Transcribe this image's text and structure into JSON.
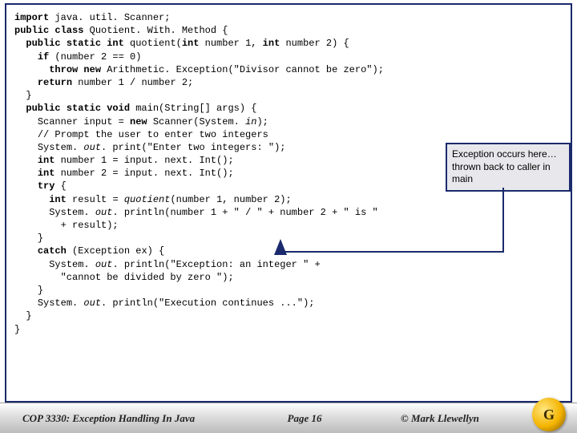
{
  "code": {
    "lines": [
      {
        "indent": 0,
        "segs": [
          {
            "t": "import ",
            "c": "kw"
          },
          {
            "t": "java. util. Scanner;"
          }
        ]
      },
      {
        "indent": 0,
        "segs": [
          {
            "t": ""
          }
        ]
      },
      {
        "indent": 0,
        "segs": [
          {
            "t": "public class ",
            "c": "kw"
          },
          {
            "t": "Quotient. With. Method {"
          }
        ]
      },
      {
        "indent": 1,
        "segs": [
          {
            "t": "public static int ",
            "c": "kw"
          },
          {
            "t": "quotient("
          },
          {
            "t": "int ",
            "c": "kw"
          },
          {
            "t": "number 1, "
          },
          {
            "t": "int ",
            "c": "kw"
          },
          {
            "t": "number 2) {"
          }
        ]
      },
      {
        "indent": 2,
        "segs": [
          {
            "t": "if ",
            "c": "kw"
          },
          {
            "t": "(number 2 == 0)"
          }
        ]
      },
      {
        "indent": 3,
        "segs": [
          {
            "t": "throw new ",
            "c": "kw"
          },
          {
            "t": "Arithmetic. Exception(\"Divisor cannot be zero\");"
          }
        ]
      },
      {
        "indent": 2,
        "segs": [
          {
            "t": "return ",
            "c": "kw"
          },
          {
            "t": "number 1 / number 2;"
          }
        ]
      },
      {
        "indent": 1,
        "segs": [
          {
            "t": "}"
          }
        ]
      },
      {
        "indent": 0,
        "segs": [
          {
            "t": ""
          }
        ]
      },
      {
        "indent": 1,
        "segs": [
          {
            "t": "public static void ",
            "c": "kw"
          },
          {
            "t": "main(String[] args) {"
          }
        ]
      },
      {
        "indent": 2,
        "segs": [
          {
            "t": "Scanner input = "
          },
          {
            "t": "new ",
            "c": "kw"
          },
          {
            "t": "Scanner(System. "
          },
          {
            "t": "in",
            "c": "it"
          },
          {
            "t": ");"
          }
        ]
      },
      {
        "indent": 0,
        "segs": [
          {
            "t": ""
          }
        ]
      },
      {
        "indent": 2,
        "segs": [
          {
            "t": "// Prompt the user to enter two integers"
          }
        ]
      },
      {
        "indent": 2,
        "segs": [
          {
            "t": "System. "
          },
          {
            "t": "out",
            "c": "it"
          },
          {
            "t": ". print(\"Enter two integers: \");"
          }
        ]
      },
      {
        "indent": 2,
        "segs": [
          {
            "t": "int ",
            "c": "kw"
          },
          {
            "t": "number 1 = input. next. Int();"
          }
        ]
      },
      {
        "indent": 2,
        "segs": [
          {
            "t": "int ",
            "c": "kw"
          },
          {
            "t": "number 2 = input. next. Int();"
          }
        ]
      },
      {
        "indent": 2,
        "segs": [
          {
            "t": "try ",
            "c": "kw"
          },
          {
            "t": "{"
          }
        ]
      },
      {
        "indent": 3,
        "segs": [
          {
            "t": "int ",
            "c": "kw"
          },
          {
            "t": "result = "
          },
          {
            "t": "quotient",
            "c": "it"
          },
          {
            "t": "(number 1, number 2);"
          }
        ]
      },
      {
        "indent": 3,
        "segs": [
          {
            "t": "System. "
          },
          {
            "t": "out",
            "c": "it"
          },
          {
            "t": ". println(number 1 + \" / \" + number 2 + \" is \""
          }
        ]
      },
      {
        "indent": 4,
        "segs": [
          {
            "t": "+ result);"
          }
        ]
      },
      {
        "indent": 2,
        "segs": [
          {
            "t": "}"
          }
        ]
      },
      {
        "indent": 2,
        "segs": [
          {
            "t": "catch ",
            "c": "kw"
          },
          {
            "t": "(Exception ex) {"
          }
        ]
      },
      {
        "indent": 3,
        "segs": [
          {
            "t": "System. "
          },
          {
            "t": "out",
            "c": "it"
          },
          {
            "t": ". println(\"Exception: an integer \" +"
          }
        ]
      },
      {
        "indent": 4,
        "segs": [
          {
            "t": "\"cannot be divided by zero \");"
          }
        ]
      },
      {
        "indent": 2,
        "segs": [
          {
            "t": "}"
          }
        ]
      },
      {
        "indent": 2,
        "segs": [
          {
            "t": "System. "
          },
          {
            "t": "out",
            "c": "it"
          },
          {
            "t": ". println(\"Execution continues ...\");"
          }
        ]
      },
      {
        "indent": 1,
        "segs": [
          {
            "t": "}"
          }
        ]
      },
      {
        "indent": 0,
        "segs": [
          {
            "t": "}"
          }
        ]
      }
    ]
  },
  "annotation": {
    "text": "Exception occurs here… thrown back to caller in main"
  },
  "footer": {
    "course": "COP 3330: Exception Handling In Java",
    "page": "Page 16",
    "author": "© Mark Llewellyn",
    "logo_letter": "G"
  }
}
